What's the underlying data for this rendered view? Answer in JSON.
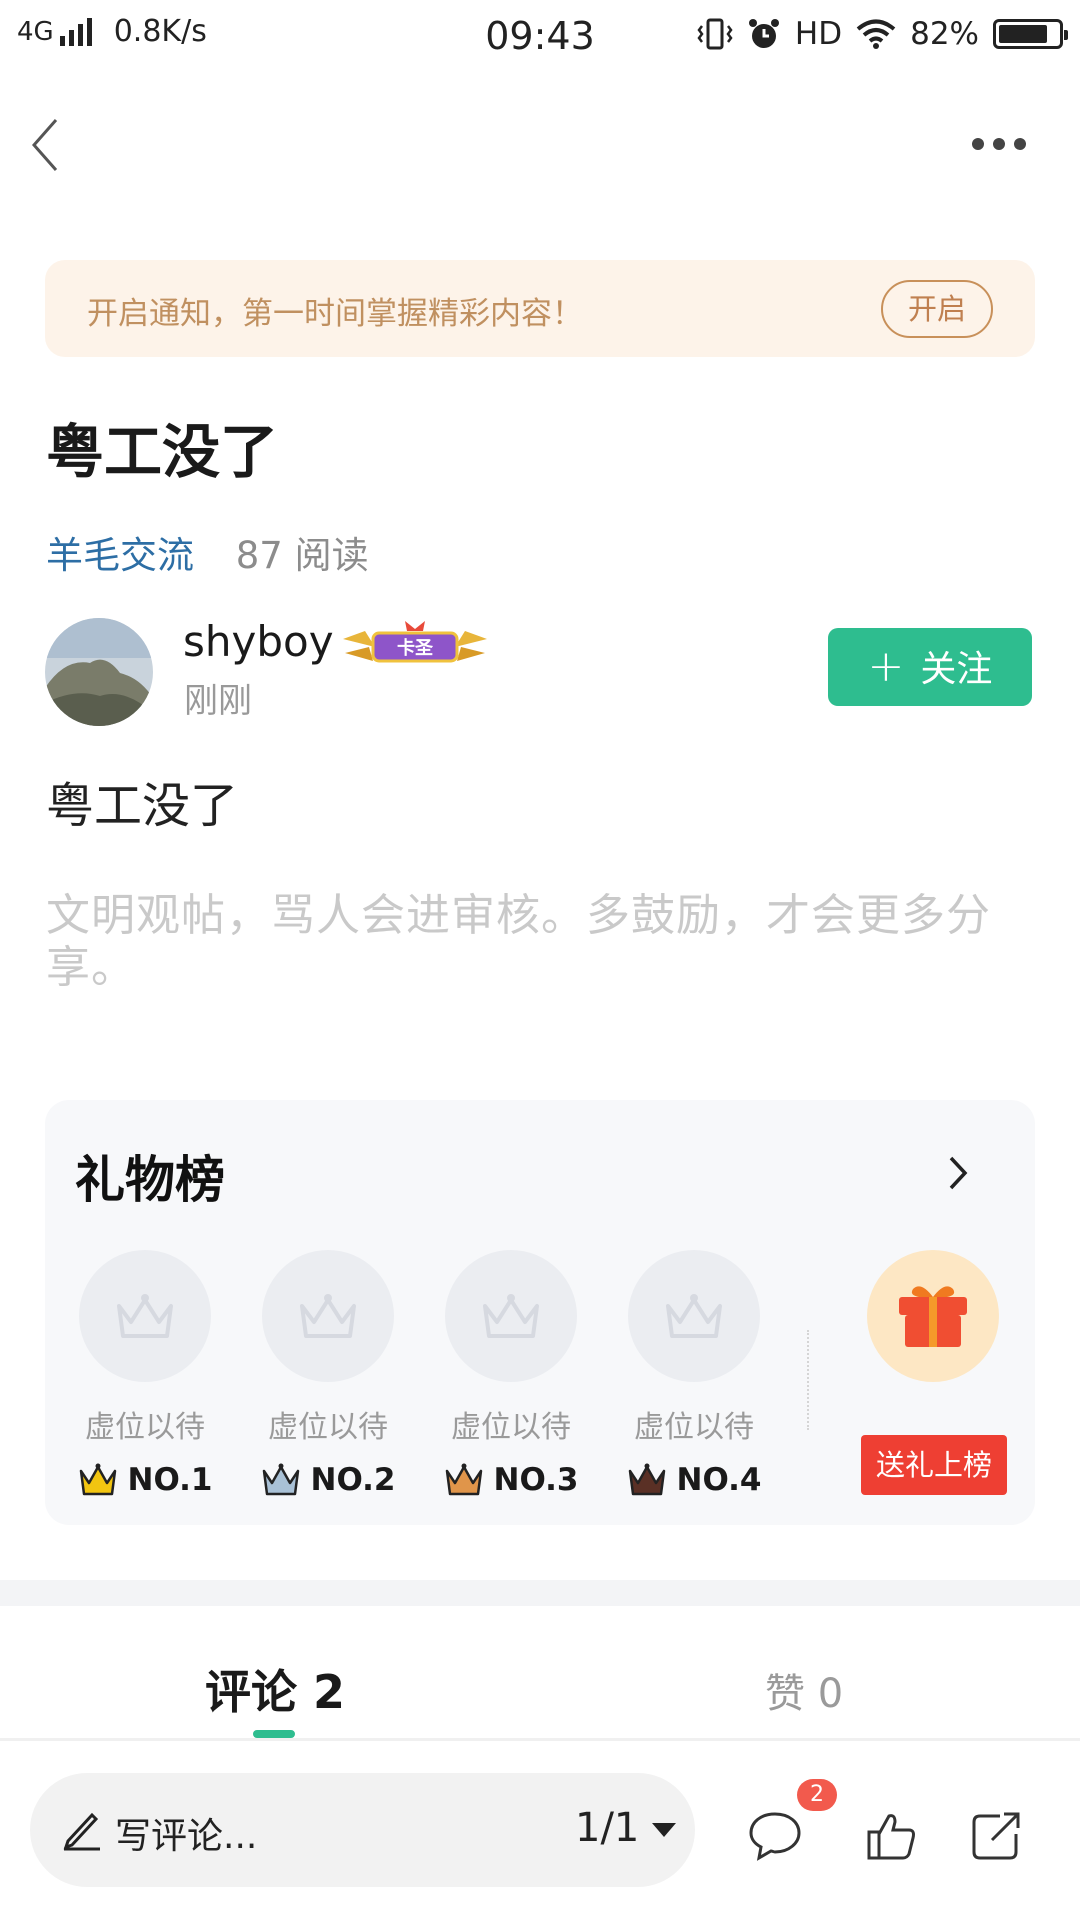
{
  "status_bar": {
    "network": "4G",
    "speed": "0.8K/s",
    "time": "09:43",
    "hd": "HD",
    "battery": "82%",
    "battery_level": 0.82
  },
  "notify": {
    "text": "开启通知，第一时间掌握精彩内容！",
    "button": "开启"
  },
  "post": {
    "title": "粤工没了",
    "category": "羊毛交流",
    "reads": "87 阅读",
    "body": "粤工没了",
    "hint": "文明观帖，骂人会进审核。多鼓励，才会更多分享。"
  },
  "author": {
    "name": "shyboy",
    "badge": "卡圣",
    "time": "刚刚",
    "follow_label": "关注"
  },
  "gift_rank": {
    "title": "礼物榜",
    "slots": [
      {
        "label": "虚位以待",
        "rank": "NO.1",
        "crown_color": "#f2c511"
      },
      {
        "label": "虚位以待",
        "rank": "NO.2",
        "crown_color": "#a9c1d6"
      },
      {
        "label": "虚位以待",
        "rank": "NO.3",
        "crown_color": "#e0954a"
      },
      {
        "label": "虚位以待",
        "rank": "NO.4",
        "crown_color": "#5a3025"
      }
    ],
    "send_button": "送礼上榜"
  },
  "tabs": {
    "comments": "评论 2",
    "likes": "赞 0"
  },
  "bottom_bar": {
    "input_placeholder": "写评论...",
    "page": "1/1",
    "comment_badge": "2"
  },
  "colors": {
    "accent": "#2ebd8f",
    "category": "#2d6ea5",
    "send_button": "#ee3f33",
    "notify_bg": "#fdf3e9"
  }
}
